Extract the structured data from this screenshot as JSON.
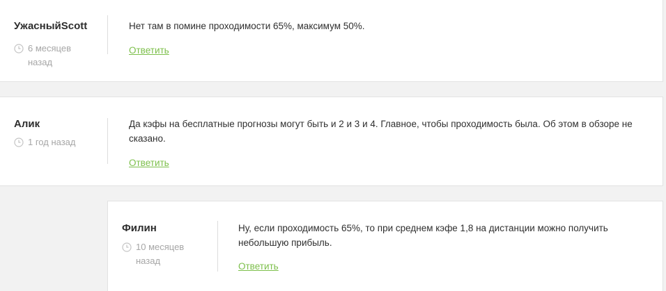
{
  "comments": [
    {
      "author": "УжасныйScott",
      "time": "6 месяцев назад",
      "text": "Нет там в помине проходимости 65%, максимум 50%.",
      "reply_label": "Ответить",
      "clock_icon": "clock-icon"
    },
    {
      "author": "Алик",
      "time": "1 год назад",
      "text": "Да кэфы на бесплатные прогнозы могут быть и 2 и 3 и 4. Главное, чтобы проходимость была. Об этом в обзоре не сказано.",
      "reply_label": "Ответить",
      "clock_icon": "clock-icon"
    },
    {
      "author": "Филин",
      "time": "10 месяцев назад",
      "text": "Ну, если проходимость 65%, то при среднем кэфе 1,8 на дистанции можно получить небольшую прибыль.",
      "reply_label": "Ответить",
      "clock_icon": "clock-icon"
    }
  ],
  "colors": {
    "reply_link": "#7cbf4a",
    "meta_text": "#a6a6a6",
    "background": "#f2f2f2",
    "card": "#ffffff"
  }
}
